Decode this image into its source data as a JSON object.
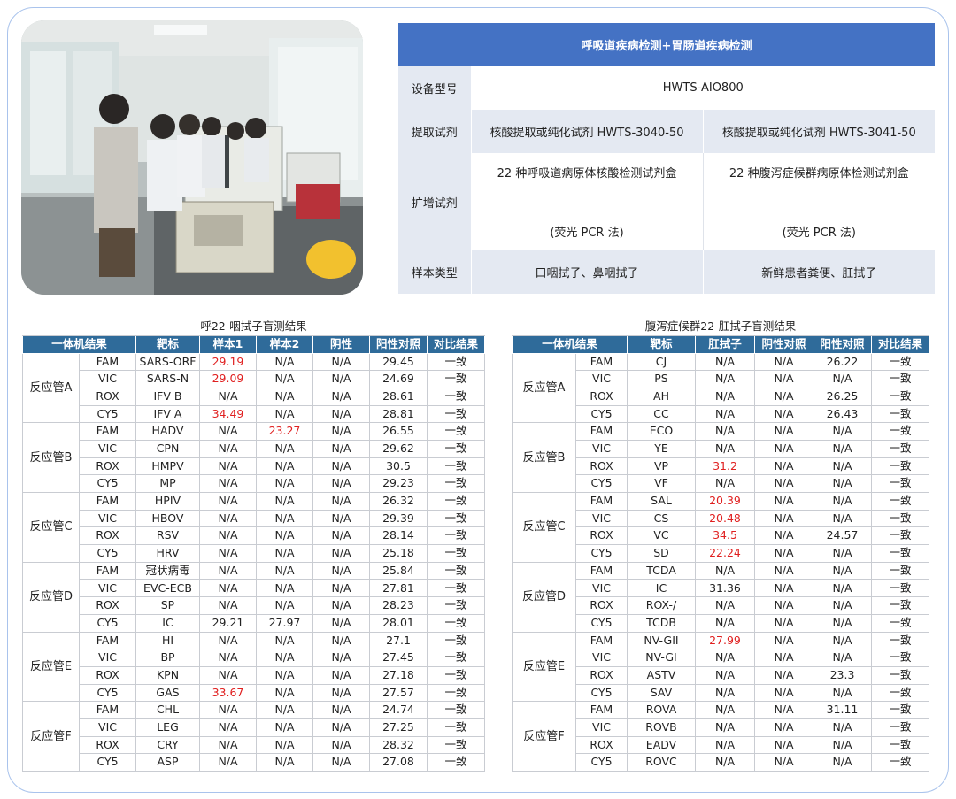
{
  "spec": {
    "title": "呼吸道疾病检测+胃肠道疾病检测",
    "rows": [
      {
        "label": "设备型号",
        "values": [
          "HWTS-AIO800"
        ]
      },
      {
        "label": "提取试剂",
        "values": [
          "核酸提取或纯化试剂 HWTS-3040-50",
          "核酸提取或纯化试剂 HWTS-3041-50"
        ]
      },
      {
        "label": "扩增试剂",
        "values": [
          "22 种呼吸道病原体核酸检测试剂盒",
          "22 种腹泻症候群病原体检测试剂盒"
        ],
        "sub": [
          "(荧光 PCR 法)",
          "(荧光 PCR 法)"
        ]
      },
      {
        "label": "样本类型",
        "values": [
          "口咽拭子、鼻咽拭子",
          "新鲜患者粪便、肛拭子"
        ]
      }
    ]
  },
  "colors": {
    "header_blue": "#4472c4",
    "table_head": "#2f6b9a",
    "positive_red": "#e02020",
    "frame": "#a9c3ec"
  },
  "left_table": {
    "title": "呼22-咽拭子盲测结果",
    "headers": [
      "一体机结果",
      "靶标",
      "样本1",
      "样本2",
      "阴性",
      "阳性对照",
      "对比结果"
    ],
    "groups": [
      {
        "tube": "反应管A",
        "rows": [
          [
            "FAM",
            "SARS-ORF",
            "29.19",
            "N/A",
            "N/A",
            "29.45",
            "一致"
          ],
          [
            "VIC",
            "SARS-N",
            "29.09",
            "N/A",
            "N/A",
            "24.69",
            "一致"
          ],
          [
            "ROX",
            "IFV B",
            "N/A",
            "N/A",
            "N/A",
            "28.61",
            "一致"
          ],
          [
            "CY5",
            "IFV A",
            "34.49",
            "N/A",
            "N/A",
            "28.81",
            "一致"
          ]
        ]
      },
      {
        "tube": "反应管B",
        "rows": [
          [
            "FAM",
            "HADV",
            "N/A",
            "23.27",
            "N/A",
            "26.55",
            "一致"
          ],
          [
            "VIC",
            "CPN",
            "N/A",
            "N/A",
            "N/A",
            "29.62",
            "一致"
          ],
          [
            "ROX",
            "HMPV",
            "N/A",
            "N/A",
            "N/A",
            "30.5",
            "一致"
          ],
          [
            "CY5",
            "MP",
            "N/A",
            "N/A",
            "N/A",
            "29.23",
            "一致"
          ]
        ]
      },
      {
        "tube": "反应管C",
        "rows": [
          [
            "FAM",
            "HPIV",
            "N/A",
            "N/A",
            "N/A",
            "26.32",
            "一致"
          ],
          [
            "VIC",
            "HBOV",
            "N/A",
            "N/A",
            "N/A",
            "29.39",
            "一致"
          ],
          [
            "ROX",
            "RSV",
            "N/A",
            "N/A",
            "N/A",
            "28.14",
            "一致"
          ],
          [
            "CY5",
            "HRV",
            "N/A",
            "N/A",
            "N/A",
            "25.18",
            "一致"
          ]
        ]
      },
      {
        "tube": "反应管D",
        "rows": [
          [
            "FAM",
            "冠状病毒",
            "N/A",
            "N/A",
            "N/A",
            "25.84",
            "一致"
          ],
          [
            "VIC",
            "EVC-ECB",
            "N/A",
            "N/A",
            "N/A",
            "27.81",
            "一致"
          ],
          [
            "ROX",
            "SP",
            "N/A",
            "N/A",
            "N/A",
            "28.23",
            "一致"
          ],
          [
            "CY5",
            "IC",
            "29.21",
            "27.97",
            "N/A",
            "28.01",
            "一致"
          ]
        ]
      },
      {
        "tube": "反应管E",
        "rows": [
          [
            "FAM",
            "HI",
            "N/A",
            "N/A",
            "N/A",
            "27.1",
            "一致"
          ],
          [
            "VIC",
            "BP",
            "N/A",
            "N/A",
            "N/A",
            "27.45",
            "一致"
          ],
          [
            "ROX",
            "KPN",
            "N/A",
            "N/A",
            "N/A",
            "27.18",
            "一致"
          ],
          [
            "CY5",
            "GAS",
            "33.67",
            "N/A",
            "N/A",
            "27.57",
            "一致"
          ]
        ]
      },
      {
        "tube": "反应管F",
        "rows": [
          [
            "FAM",
            "CHL",
            "N/A",
            "N/A",
            "N/A",
            "24.74",
            "一致"
          ],
          [
            "VIC",
            "LEG",
            "N/A",
            "N/A",
            "N/A",
            "27.25",
            "一致"
          ],
          [
            "ROX",
            "CRY",
            "N/A",
            "N/A",
            "N/A",
            "28.32",
            "一致"
          ],
          [
            "CY5",
            "ASP",
            "N/A",
            "N/A",
            "N/A",
            "27.08",
            "一致"
          ]
        ]
      }
    ],
    "red_cells": [
      "0-0-2",
      "0-1-2",
      "0-3-2",
      "1-0-3",
      "4-3-2"
    ]
  },
  "right_table": {
    "title": "腹泻症候群22-肛拭子盲测结果",
    "headers": [
      "一体机结果",
      "靶标",
      "肛拭子",
      "阴性对照",
      "阳性对照",
      "对比结果"
    ],
    "groups": [
      {
        "tube": "反应管A",
        "rows": [
          [
            "FAM",
            "CJ",
            "N/A",
            "N/A",
            "26.22",
            "一致"
          ],
          [
            "VIC",
            "PS",
            "N/A",
            "N/A",
            "N/A",
            "一致"
          ],
          [
            "ROX",
            "AH",
            "N/A",
            "N/A",
            "26.25",
            "一致"
          ],
          [
            "CY5",
            "CC",
            "N/A",
            "N/A",
            "26.43",
            "一致"
          ]
        ]
      },
      {
        "tube": "反应管B",
        "rows": [
          [
            "FAM",
            "ECO",
            "N/A",
            "N/A",
            "N/A",
            "一致"
          ],
          [
            "VIC",
            "YE",
            "N/A",
            "N/A",
            "N/A",
            "一致"
          ],
          [
            "ROX",
            "VP",
            "31.2",
            "N/A",
            "N/A",
            "一致"
          ],
          [
            "CY5",
            "VF",
            "N/A",
            "N/A",
            "N/A",
            "一致"
          ]
        ]
      },
      {
        "tube": "反应管C",
        "rows": [
          [
            "FAM",
            "SAL",
            "20.39",
            "N/A",
            "N/A",
            "一致"
          ],
          [
            "VIC",
            "CS",
            "20.48",
            "N/A",
            "N/A",
            "一致"
          ],
          [
            "ROX",
            "VC",
            "34.5",
            "N/A",
            "24.57",
            "一致"
          ],
          [
            "CY5",
            "SD",
            "22.24",
            "N/A",
            "N/A",
            "一致"
          ]
        ]
      },
      {
        "tube": "反应管D",
        "rows": [
          [
            "FAM",
            "TCDA",
            "N/A",
            "N/A",
            "N/A",
            "一致"
          ],
          [
            "VIC",
            "IC",
            "31.36",
            "N/A",
            "N/A",
            "一致"
          ],
          [
            "ROX",
            "ROX-/",
            "N/A",
            "N/A",
            "N/A",
            "一致"
          ],
          [
            "CY5",
            "TCDB",
            "N/A",
            "N/A",
            "N/A",
            "一致"
          ]
        ]
      },
      {
        "tube": "反应管E",
        "rows": [
          [
            "FAM",
            "NV-GII",
            "27.99",
            "N/A",
            "N/A",
            "一致"
          ],
          [
            "VIC",
            "NV-GI",
            "N/A",
            "N/A",
            "N/A",
            "一致"
          ],
          [
            "ROX",
            "ASTV",
            "N/A",
            "N/A",
            "23.3",
            "一致"
          ],
          [
            "CY5",
            "SAV",
            "N/A",
            "N/A",
            "N/A",
            "一致"
          ]
        ]
      },
      {
        "tube": "反应管F",
        "rows": [
          [
            "FAM",
            "ROVA",
            "N/A",
            "N/A",
            "31.11",
            "一致"
          ],
          [
            "VIC",
            "ROVB",
            "N/A",
            "N/A",
            "N/A",
            "一致"
          ],
          [
            "ROX",
            "EADV",
            "N/A",
            "N/A",
            "N/A",
            "一致"
          ],
          [
            "CY5",
            "ROVC",
            "N/A",
            "N/A",
            "N/A",
            "一致"
          ]
        ]
      }
    ],
    "red_cells": [
      "1-2-2",
      "2-0-2",
      "2-1-2",
      "2-2-2",
      "2-3-2",
      "4-0-2"
    ]
  }
}
